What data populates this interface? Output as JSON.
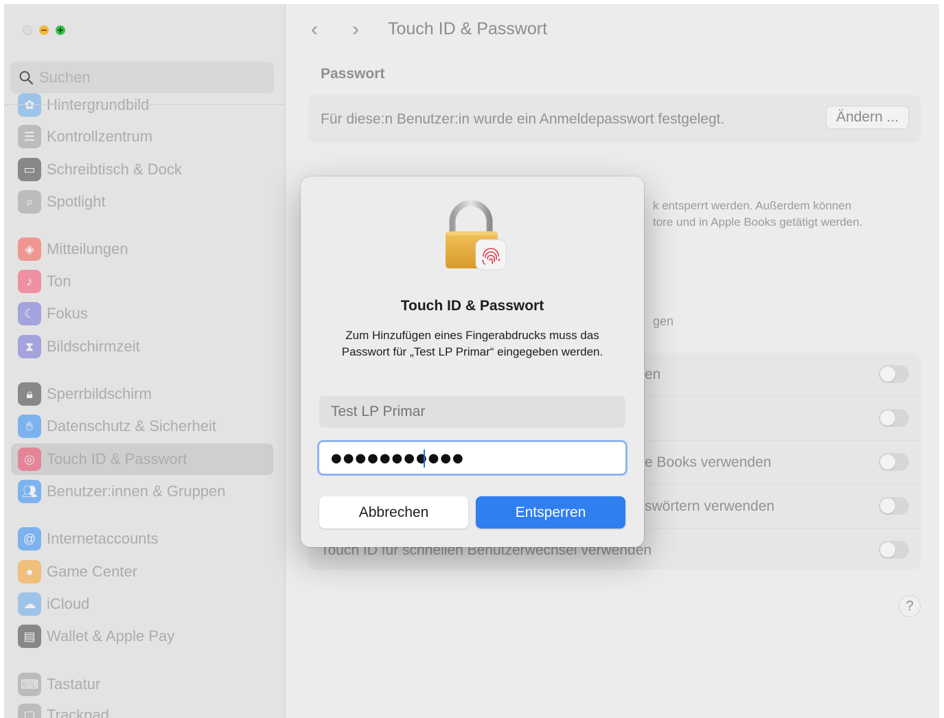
{
  "sidebar": {
    "search_placeholder": "Suchen",
    "items": [
      {
        "label": "Hintergrundbild",
        "icon": "wallpaper-icon",
        "color": "#4aa0f0"
      },
      {
        "label": "Kontrollzentrum",
        "icon": "control-center-icon",
        "color": "#8e8e93"
      },
      {
        "label": "Schreibtisch & Dock",
        "icon": "dock-icon",
        "color": "#1c1c1e"
      },
      {
        "label": "Spotlight",
        "icon": "spotlight-icon",
        "color": "#8e8e93"
      },
      {
        "label": "Mitteilungen",
        "icon": "notifications-icon",
        "color": "#ff3b30"
      },
      {
        "label": "Ton",
        "icon": "sound-icon",
        "color": "#ff2d55"
      },
      {
        "label": "Fokus",
        "icon": "focus-icon",
        "color": "#5856d6"
      },
      {
        "label": "Bildschirmzeit",
        "icon": "screen-time-icon",
        "color": "#5856d6"
      },
      {
        "label": "Sperrbildschirm",
        "icon": "lock-screen-icon",
        "color": "#1c1c1e"
      },
      {
        "label": "Datenschutz & Sicherheit",
        "icon": "privacy-hand-icon",
        "color": "#007aff"
      },
      {
        "label": "Touch ID & Passwort",
        "icon": "fingerprint-icon",
        "color": "#ff2d55"
      },
      {
        "label": "Benutzer:innen & Gruppen",
        "icon": "users-icon",
        "color": "#007aff"
      },
      {
        "label": "Internetaccounts",
        "icon": "at-icon",
        "color": "#007aff"
      },
      {
        "label": "Game Center",
        "icon": "game-center-icon",
        "color": "#ff9500"
      },
      {
        "label": "iCloud",
        "icon": "icloud-icon",
        "color": "#4aa0f0"
      },
      {
        "label": "Wallet & Apple Pay",
        "icon": "wallet-icon",
        "color": "#1c1c1e"
      },
      {
        "label": "Tastatur",
        "icon": "keyboard-icon",
        "color": "#8e8e93"
      },
      {
        "label": "Trackpad",
        "icon": "trackpad-icon",
        "color": "#8e8e93"
      }
    ]
  },
  "main": {
    "title": "Touch ID & Passwort",
    "password_section": "Passwort",
    "password_text": "Für diese:n Benutzer:in wurde ein Anmeldepasswort festgelegt.",
    "change_button": "Ändern ...",
    "desc_line1": "k entsperrt werden. Außerdem können",
    "desc_line2": "tore und in Apple Books getätigt werden.",
    "fragment_gen": "gen",
    "toggle_rows": [
      {
        "label": "en"
      },
      {
        "label": ""
      },
      {
        "label": "e Books verwenden"
      },
      {
        "label": "swörtern verwenden"
      },
      {
        "label": "Touch ID für schnellen Benutzerwechsel verwenden"
      }
    ],
    "help": "?"
  },
  "dialog": {
    "title": "Touch ID & Passwort",
    "message": "Zum Hinzufügen eines Fingerabdrucks muss das Passwort für „Test LP Primar“ eingegeben werden.",
    "username": "Test LP Primar",
    "password_value": "●●●●●●●●●●●",
    "cancel": "Abbrechen",
    "unlock": "Entsperren"
  }
}
